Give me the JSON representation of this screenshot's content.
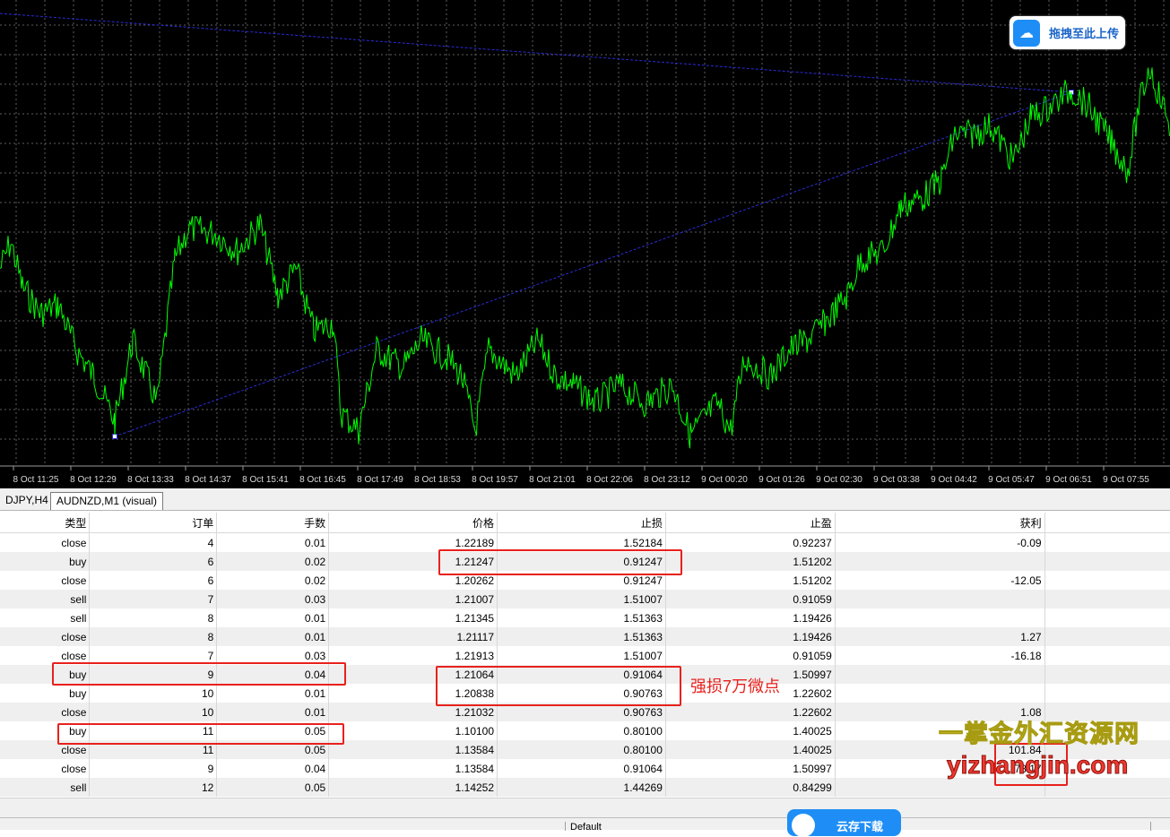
{
  "chart": {
    "background": "#000000",
    "line_color": "#00ff00",
    "trend_color": "#2b2bd9",
    "x_ticks": [
      "8 Oct 11:25",
      "8 Oct 12:29",
      "8 Oct 13:33",
      "8 Oct 14:37",
      "8 Oct 15:41",
      "8 Oct 16:45",
      "8 Oct 17:49",
      "8 Oct 18:53",
      "8 Oct 19:57",
      "8 Oct 21:01",
      "8 Oct 22:06",
      "8 Oct 23:12",
      "9 Oct 00:20",
      "9 Oct 01:26",
      "9 Oct 02:30",
      "9 Oct 03:38",
      "9 Oct 04:42",
      "9 Oct 05:47",
      "9 Oct 06:51",
      "9 Oct 07:55"
    ]
  },
  "upload_button": {
    "label": "拖拽至此上传",
    "icon": "cloud-upload-icon"
  },
  "tabs": [
    {
      "label": "DJPY,H4"
    },
    {
      "label": "AUDNZD,M1 (visual)"
    }
  ],
  "table": {
    "columns": [
      "类型",
      "订单",
      "手数",
      "价格",
      "止损",
      "止盈",
      "获利"
    ],
    "rows": [
      [
        "close",
        "4",
        "0.01",
        "1.22189",
        "1.52184",
        "0.92237",
        "-0.09"
      ],
      [
        "buy",
        "6",
        "0.02",
        "1.21247",
        "0.91247",
        "1.51202",
        ""
      ],
      [
        "close",
        "6",
        "0.02",
        "1.20262",
        "0.91247",
        "1.51202",
        "-12.05"
      ],
      [
        "sell",
        "7",
        "0.03",
        "1.21007",
        "1.51007",
        "0.91059",
        ""
      ],
      [
        "sell",
        "8",
        "0.01",
        "1.21345",
        "1.51363",
        "1.19426",
        ""
      ],
      [
        "close",
        "8",
        "0.01",
        "1.21117",
        "1.51363",
        "1.19426",
        "1.27"
      ],
      [
        "close",
        "7",
        "0.03",
        "1.21913",
        "1.51007",
        "0.91059",
        "-16.18"
      ],
      [
        "buy",
        "9",
        "0.04",
        "1.21064",
        "0.91064",
        "1.50997",
        ""
      ],
      [
        "buy",
        "10",
        "0.01",
        "1.20838",
        "0.90763",
        "1.22602",
        ""
      ],
      [
        "close",
        "10",
        "0.01",
        "1.21032",
        "0.90763",
        "1.22602",
        "1.08"
      ],
      [
        "buy",
        "11",
        "0.05",
        "1.10100",
        "0.80100",
        "1.40025",
        ""
      ],
      [
        "close",
        "11",
        "0.05",
        "1.13584",
        "0.80100",
        "1.40025",
        "101.84"
      ],
      [
        "close",
        "9",
        "0.04",
        "1.13584",
        "0.91064",
        "1.50997",
        "78.17"
      ],
      [
        "sell",
        "12",
        "0.05",
        "1.14252",
        "1.44269",
        "0.84299",
        ""
      ]
    ]
  },
  "annotation": "强损7万微点",
  "watermark": {
    "line1": "一掌金外汇资源网",
    "line2": "yizhangjin.com"
  },
  "status": {
    "profile": "Default"
  },
  "cloud_button": {
    "label": "云存下载"
  }
}
